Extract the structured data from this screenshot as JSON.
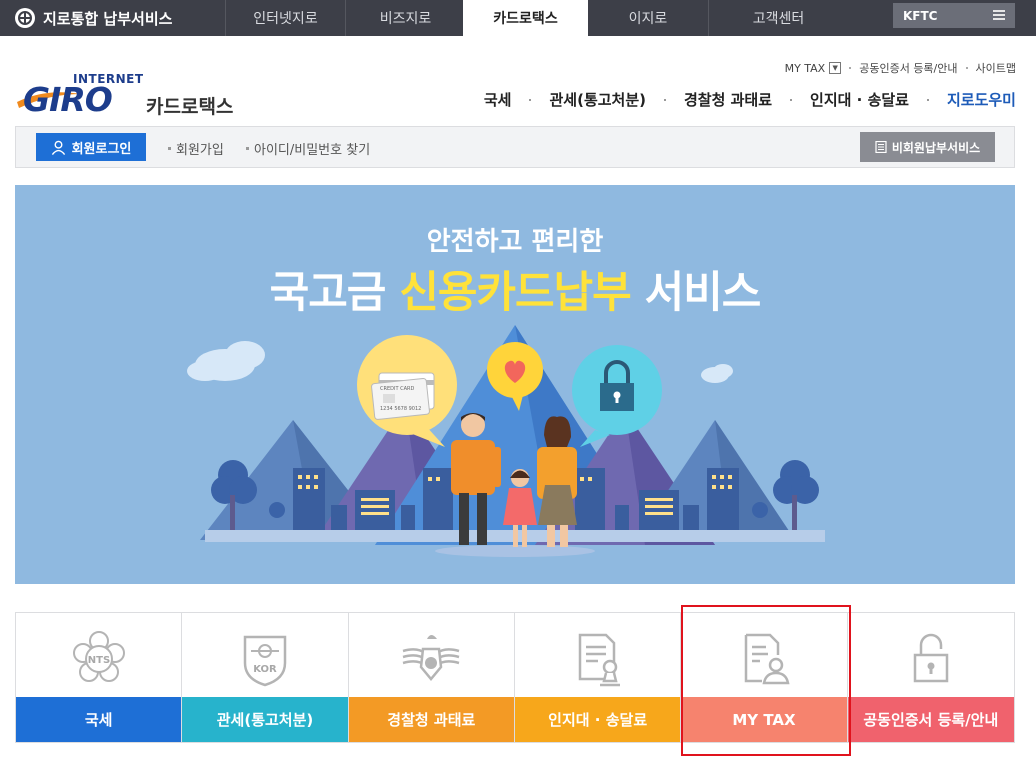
{
  "topbar": {
    "brand": "지로통합 납부서비스",
    "tabs": [
      {
        "label": "인터넷지로"
      },
      {
        "label": "비즈지로"
      },
      {
        "label": "카드로택스"
      },
      {
        "label": "이지로"
      },
      {
        "label": "고객센터"
      }
    ],
    "kftc": "KFTC"
  },
  "logo": {
    "internet": "INTERNET",
    "giro": "GIRO",
    "service": "카드로택스"
  },
  "util": {
    "mytax": "MY TAX",
    "cert": "공동인증서 등록/안내",
    "sitemap": "사이트맵"
  },
  "gnav": {
    "items": [
      "국세",
      "관세(통고처분)",
      "경찰청 과태료",
      "인지대 · 송달료"
    ],
    "help": "지로도우미"
  },
  "loginbar": {
    "login": "회원로그인",
    "join": "회원가입",
    "find": "아이디/비밀번호 찾기",
    "guest": "비회원납부서비스"
  },
  "banner": {
    "line1": "안전하고 편리한",
    "line2_pre": "국고금 ",
    "line2_hl": "신용카드납부",
    "line2_post": " 서비스",
    "card_text": "CREDIT CARD",
    "card_number": "1234 5678 9012"
  },
  "quick": [
    {
      "label": "국세",
      "badge": "NTS"
    },
    {
      "label": "관세(통고처분)",
      "badge": "KOR"
    },
    {
      "label": "경찰청 과태료"
    },
    {
      "label": "인지대 · 송달료"
    },
    {
      "label": "MY TAX"
    },
    {
      "label": "공동인증서 등록/안내"
    }
  ],
  "colors": {
    "accent_blue": "#1e6fd6",
    "banner_bg": "#8fb9e0",
    "highlight": "#e0131d"
  }
}
